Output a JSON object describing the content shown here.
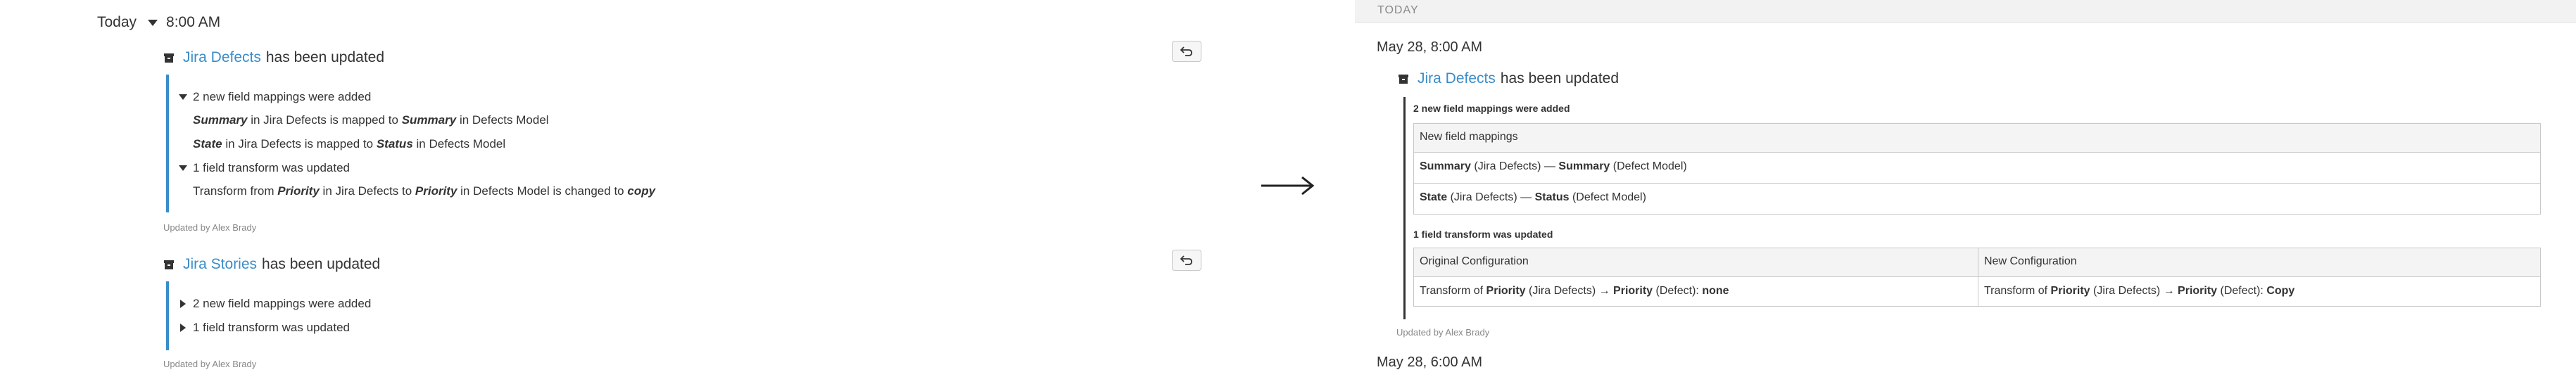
{
  "left": {
    "group": {
      "day": "Today",
      "time": "8:00 AM"
    },
    "events": [
      {
        "source": "Jira Defects",
        "suffix": "has been updated",
        "sections": [
          {
            "summary": "2 new field mappings were added",
            "items": [
              {
                "a": "Summary",
                "mid": "in Jira Defects is mapped to",
                "b": "Summary",
                "end": "in Defects Model"
              },
              {
                "a": "State",
                "mid": "in Jira Defects is mapped to",
                "b": "Status",
                "end": "in Defects Model"
              }
            ]
          },
          {
            "summary": "1 field transform was updated",
            "items": [
              {
                "pre": "Transform from",
                "a": "Priority",
                "mid": "in Jira Defects to",
                "b": "Priority",
                "end": "in Defects Model is changed to",
                "c": "copy"
              }
            ]
          }
        ],
        "updated_by": "Updated by Alex Brady"
      },
      {
        "source": "Jira Stories",
        "suffix": "has been updated",
        "sections": [
          {
            "summary": "2 new field mappings were added"
          },
          {
            "summary": "1 field transform was updated"
          }
        ],
        "updated_by": "Updated by Alex Brady"
      }
    ]
  },
  "right": {
    "top_label": "TODAY",
    "date1": "May 28, 8:00 AM",
    "event": {
      "source": "Jira Defects",
      "suffix": "has been updated"
    },
    "mappings_section": "2 new field mappings were added",
    "mappings_table": {
      "header": "New field mappings",
      "rows": [
        {
          "a": "Summary",
          "a_src": "(Jira Defects) —",
          "b": "Summary",
          "b_src": "(Defect Model)"
        },
        {
          "a": "State",
          "a_src": "(Jira Defects) —",
          "b": "Status",
          "b_src": "(Defect Model)"
        }
      ]
    },
    "transform_section": "1 field transform was updated",
    "transform_table": {
      "col1": "Original Configuration",
      "col2": "New Configuration",
      "orig": {
        "pre": "Transform of",
        "a": "Priority",
        "a_src": "(Jira Defects) →",
        "b": "Priority",
        "b_src": "(Defect):",
        "val": "none"
      },
      "new": {
        "pre": "Transform of",
        "a": "Priority",
        "a_src": "(Jira Defects) →",
        "b": "Priority",
        "b_src": "(Defect):",
        "val": "Copy"
      }
    },
    "updated_by": "Updated by Alex Brady",
    "date2": "May 28, 6:00 AM"
  },
  "colors": {
    "link": "#3a8dc9",
    "bar": "#3a8dc9",
    "text": "#333333",
    "muted": "#888888"
  },
  "icons": [
    "box-icon",
    "undo-icon",
    "caret-down-icon",
    "caret-right-icon",
    "arrow-right-icon"
  ]
}
